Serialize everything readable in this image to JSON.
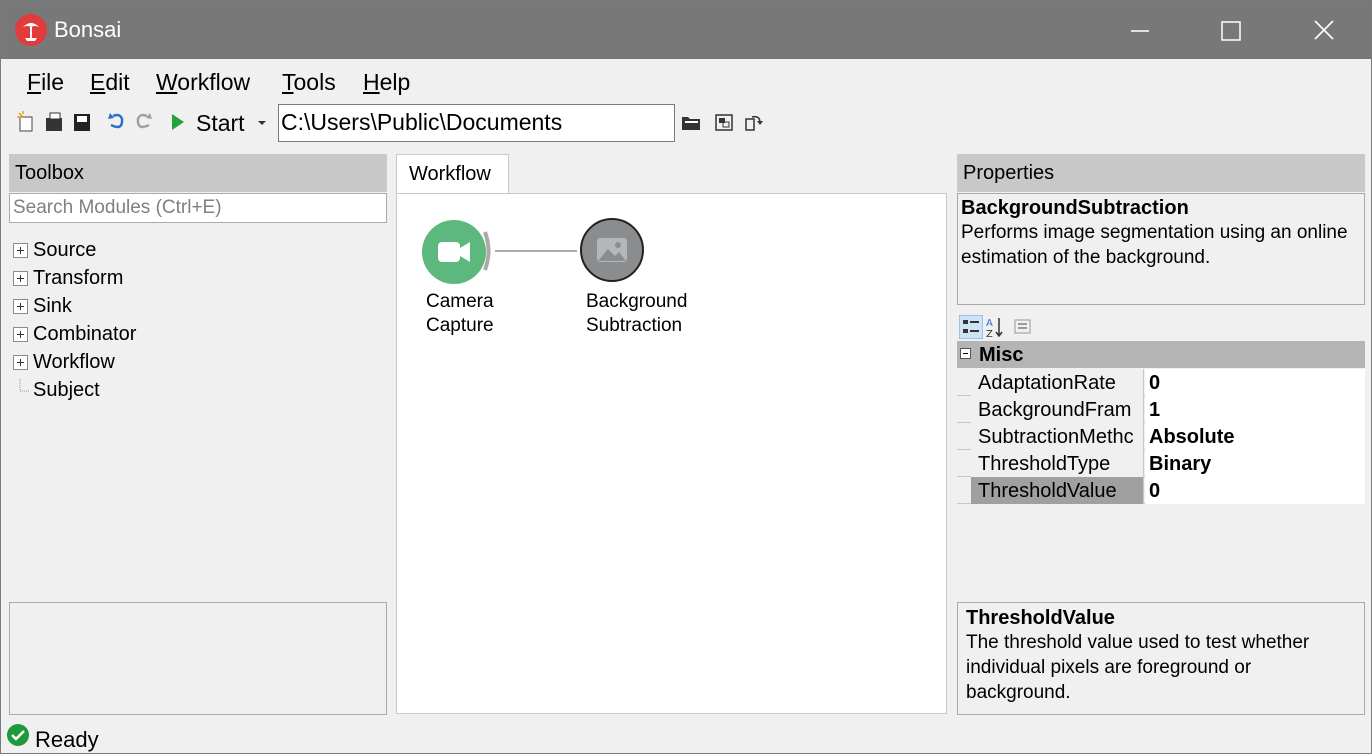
{
  "window": {
    "title": "Bonsai"
  },
  "menu": [
    {
      "prefix": "",
      "accel": "F",
      "rest": "ile"
    },
    {
      "prefix": "",
      "accel": "E",
      "rest": "dit"
    },
    {
      "prefix": "",
      "accel": "W",
      "rest": "orkflow"
    },
    {
      "prefix": "",
      "accel": "T",
      "rest": "ools"
    },
    {
      "prefix": "",
      "accel": "H",
      "rest": "elp"
    }
  ],
  "toolbar": {
    "start_label": "Start",
    "path": "C:\\Users\\Public\\Documents"
  },
  "toolbox": {
    "title": "Toolbox",
    "search_placeholder": "Search Modules (Ctrl+E)",
    "items": [
      {
        "label": "Source",
        "expandable": true
      },
      {
        "label": "Transform",
        "expandable": true
      },
      {
        "label": "Sink",
        "expandable": true
      },
      {
        "label": "Combinator",
        "expandable": true
      },
      {
        "label": "Workflow",
        "expandable": true
      },
      {
        "label": "Subject",
        "expandable": false
      }
    ]
  },
  "workflow": {
    "tab": "Workflow",
    "nodes": [
      {
        "line1": "Camera",
        "line2": "Capture",
        "color": "#5cb87c"
      },
      {
        "line1": "Background",
        "line2": "Subtraction",
        "color": "#8a8c8e"
      }
    ]
  },
  "properties": {
    "title": "Properties",
    "selected_name": "BackgroundSubtraction",
    "selected_desc": "Performs image segmentation using an online estimation of the background.",
    "category": "Misc",
    "rows": [
      {
        "name": "AdaptationRate",
        "value": "0"
      },
      {
        "name": "BackgroundFram",
        "value": "1"
      },
      {
        "name": "SubtractionMethc",
        "value": "Absolute"
      },
      {
        "name": "ThresholdType",
        "value": "Binary"
      },
      {
        "name": "ThresholdValue",
        "value": "0"
      }
    ],
    "help_name": "ThresholdValue",
    "help_text": "The threshold value used to test whether individual pixels are foreground or background."
  },
  "status": {
    "text": "Ready"
  }
}
